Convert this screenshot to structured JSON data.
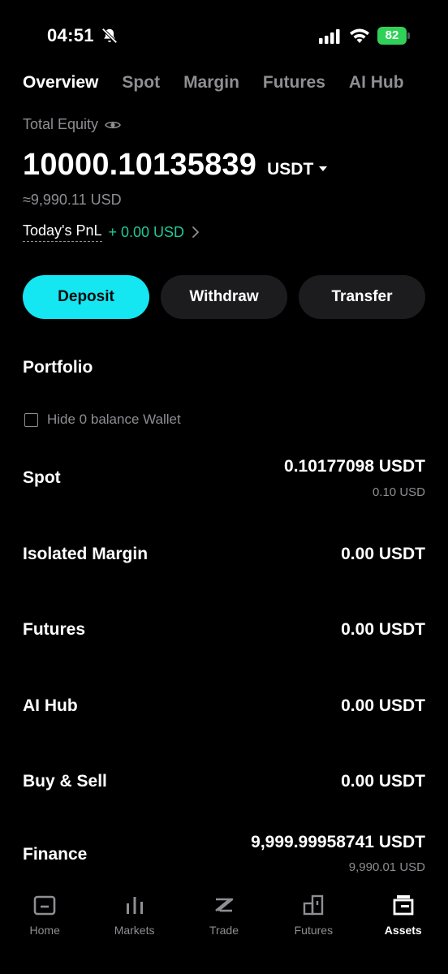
{
  "status": {
    "time": "04:51",
    "battery": "82"
  },
  "tabs": [
    "Overview",
    "Spot",
    "Margin",
    "Futures",
    "AI Hub"
  ],
  "equity": {
    "label": "Total Equity",
    "value": "10000.10135839",
    "unit": "USDT",
    "approx": "≈9,990.11 USD"
  },
  "pnl": {
    "label": "Today's PnL",
    "value": "+ 0.00 USD"
  },
  "actions": {
    "deposit": "Deposit",
    "withdraw": "Withdraw",
    "transfer": "Transfer"
  },
  "portfolio": {
    "title": "Portfolio",
    "hide_zero": "Hide 0 balance Wallet",
    "wallets": [
      {
        "name": "Spot",
        "amount": "0.10177098 USDT",
        "usd": "0.10 USD"
      },
      {
        "name": "Isolated Margin",
        "amount": "0.00 USDT"
      },
      {
        "name": "Futures",
        "amount": "0.00 USDT"
      },
      {
        "name": "AI Hub",
        "amount": "0.00 USDT"
      },
      {
        "name": "Buy & Sell",
        "amount": "0.00 USDT"
      },
      {
        "name": "Finance",
        "amount": "9,999.99958741 USDT",
        "usd": "9,990.01 USD"
      }
    ]
  },
  "nav": [
    "Home",
    "Markets",
    "Trade",
    "Futures",
    "Assets"
  ],
  "colors": {
    "accent": "#14e6f2",
    "positive": "#20c997",
    "battery": "#30d158"
  }
}
